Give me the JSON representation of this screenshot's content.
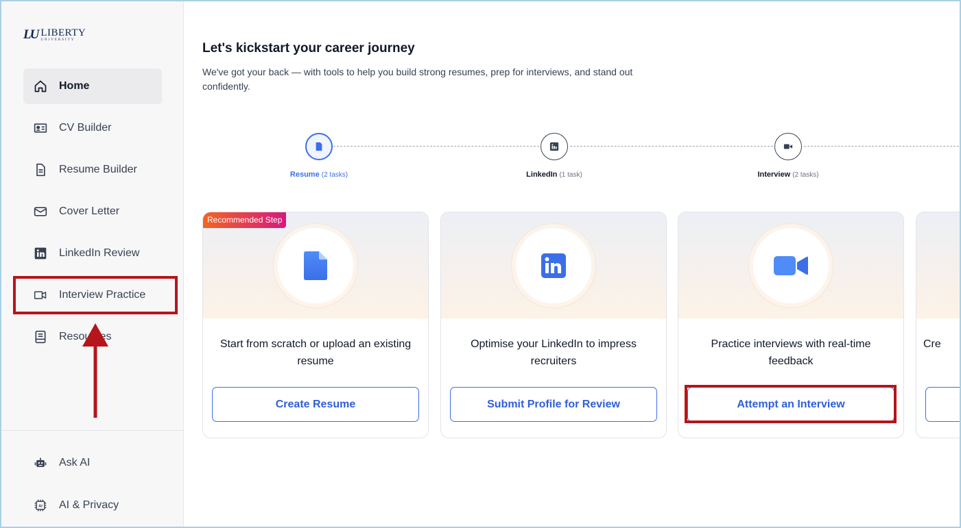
{
  "brand": {
    "logo_mark": "LU",
    "logo_word": "LIBERTY",
    "logo_sub": "UNIVERSITY"
  },
  "sidebar": {
    "items": [
      {
        "label": "Home",
        "icon": "home-icon",
        "active": true
      },
      {
        "label": "CV Builder",
        "icon": "id-card-icon"
      },
      {
        "label": "Resume Builder",
        "icon": "document-icon"
      },
      {
        "label": "Cover Letter",
        "icon": "envelope-icon"
      },
      {
        "label": "LinkedIn Review",
        "icon": "linkedin-icon"
      },
      {
        "label": "Interview Practice",
        "icon": "video-camera-icon"
      },
      {
        "label": "Resources",
        "icon": "notebook-icon"
      }
    ],
    "footer_items": [
      {
        "label": "Ask AI",
        "icon": "robot-icon"
      },
      {
        "label": "AI & Privacy",
        "icon": "ai-chip-icon"
      }
    ]
  },
  "main": {
    "title": "Let's kickstart your career journey",
    "subtitle": "We've got your back — with tools to help you build strong resumes, prep for interviews, and stand out confidently.",
    "steps": [
      {
        "label": "Resume",
        "tasks": "(2 tasks)",
        "icon": "document-icon",
        "active": true
      },
      {
        "label": "LinkedIn",
        "tasks": "(1 task)",
        "icon": "linkedin-icon"
      },
      {
        "label": "Interview",
        "tasks": "(2 tasks)",
        "icon": "video-camera-icon"
      }
    ],
    "cards": [
      {
        "badge": "Recommended Step",
        "text": "Start from scratch or upload an existing resume",
        "button": "Create Resume",
        "icon": "document-icon"
      },
      {
        "text": "Optimise your LinkedIn to impress recruiters",
        "button": "Submit Profile for Review",
        "icon": "linkedin-icon"
      },
      {
        "text": "Practice interviews with real-time feedback",
        "button": "Attempt an Interview",
        "icon": "video-camera-icon"
      },
      {
        "text": "Cre",
        "button": "",
        "icon": ""
      }
    ]
  },
  "colors": {
    "accent": "#3b6fe8",
    "highlight": "#b5151b",
    "badge_start": "#f26522",
    "badge_end": "#d6197f"
  }
}
